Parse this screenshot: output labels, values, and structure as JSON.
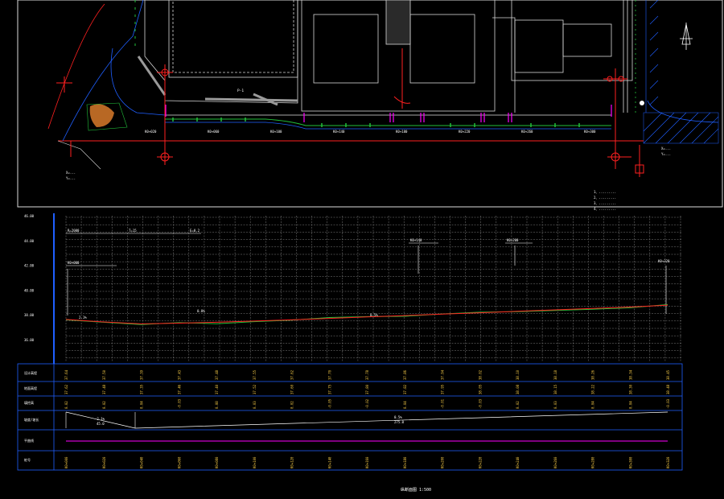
{
  "plan": {
    "site_label": "P-1",
    "notes": [
      "1、.........",
      "2、.........",
      "3、.........",
      "4、........."
    ],
    "left_coord": [
      "X=...",
      "Y=..."
    ],
    "right_coord": [
      "X=...",
      "Y=..."
    ],
    "chainage_labels": [
      "K0+020",
      "K0+060",
      "K0+100",
      "K0+140",
      "K0+180",
      "K0+220",
      "K0+260",
      "K0+300"
    ]
  },
  "profile": {
    "y_axis_labels": [
      "46.00",
      "44.00",
      "42.00",
      "40.00",
      "38.00",
      "36.00"
    ],
    "top_annotations": [
      "R=2000",
      "T=15",
      "E=0.2"
    ],
    "left_marker": "K0+000",
    "right_marker": "K0+320",
    "middle_markers": [
      "K0+140",
      "K0+200"
    ],
    "segment_labels": [
      "2.1%",
      "0.5%",
      "0.8%"
    ]
  },
  "table": {
    "row_labels": [
      "设计高程",
      "地面高程",
      "填挖高",
      "坡度/坡长",
      "平曲线",
      "桩号"
    ],
    "design_elevations": [
      "37.64",
      "37.50",
      "37.39",
      "37.43",
      "37.48",
      "37.55",
      "37.62",
      "37.70",
      "37.78",
      "37.86",
      "37.94",
      "38.02",
      "38.10",
      "38.18",
      "38.26",
      "38.34",
      "38.45"
    ],
    "ground_elevations": [
      "37.62",
      "37.48",
      "37.35",
      "37.46",
      "37.40",
      "37.52",
      "37.60",
      "37.75",
      "37.80",
      "37.82",
      "37.95",
      "38.05",
      "38.08",
      "38.15",
      "38.22",
      "38.30",
      "38.48"
    ],
    "cut_fill": [
      "0.02",
      "0.02",
      "0.04",
      "-0.03",
      "0.08",
      "0.03",
      "0.02",
      "-0.05",
      "-0.02",
      "0.04",
      "-0.01",
      "-0.03",
      "0.02",
      "0.03",
      "0.04",
      "0.04",
      "-0.03"
    ],
    "stations": [
      "K0+000",
      "K0+020",
      "K0+040",
      "K0+060",
      "K0+080",
      "K0+100",
      "K0+120",
      "K0+140",
      "K0+160",
      "K0+180",
      "K0+200",
      "K0+220",
      "K0+240",
      "K0+260",
      "K0+280",
      "K0+300",
      "K0+320"
    ],
    "grade_labels": [
      "-2.1%",
      "45.0",
      "0.5%",
      "275.0"
    ],
    "footer": "纵断面图 1:500"
  },
  "colors": {
    "background": "#000000",
    "grid": "#7f7f7f",
    "frame_blue": "#1f5fff",
    "design_line": "#ff2020",
    "ground_line": "#22c03a",
    "magenta": "#ff00ff",
    "yellow": "#ffd24a"
  }
}
